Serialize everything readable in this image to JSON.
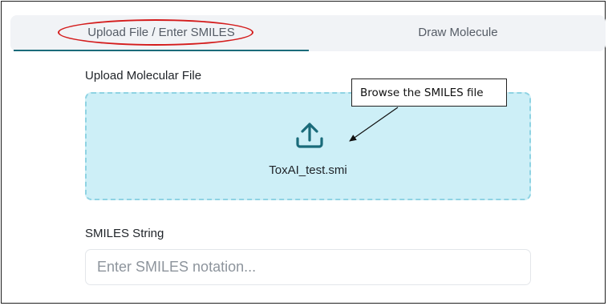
{
  "tabs": [
    {
      "label": "Upload File / Enter SMILES",
      "active": true
    },
    {
      "label": "Draw Molecule",
      "active": false
    }
  ],
  "upload": {
    "label": "Upload Molecular File",
    "file_name": "ToxAI_test.smi",
    "icon": "upload-icon"
  },
  "annotation": {
    "callout_text": "Browse the SMILES file",
    "highlight_color": "#d41c1c"
  },
  "smiles": {
    "label": "SMILES String",
    "placeholder": "Enter SMILES notation...",
    "value": ""
  },
  "colors": {
    "accent": "#1a6b7a",
    "dropzone_bg": "#cdeff7",
    "dropzone_border": "#8fd3e3"
  }
}
